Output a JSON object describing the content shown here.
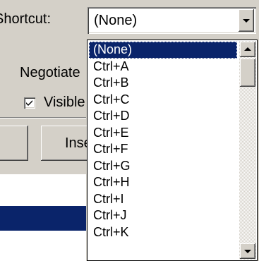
{
  "dialog": {
    "shortcut_label": "Shortcut:",
    "negotiate_label": "Negotiate",
    "visible_label": "Visible",
    "visible_checked": true,
    "insert_button_label": "Inse"
  },
  "shortcut_combo": {
    "value": "(None)",
    "options": [
      "(None)",
      "Ctrl+A",
      "Ctrl+B",
      "Ctrl+C",
      "Ctrl+D",
      "Ctrl+E",
      "Ctrl+F",
      "Ctrl+G",
      "Ctrl+H",
      "Ctrl+I",
      "Ctrl+J",
      "Ctrl+K"
    ],
    "selected_option": "(None)"
  },
  "colors": {
    "face": "#d4d0c8",
    "selection": "#0a246a"
  }
}
